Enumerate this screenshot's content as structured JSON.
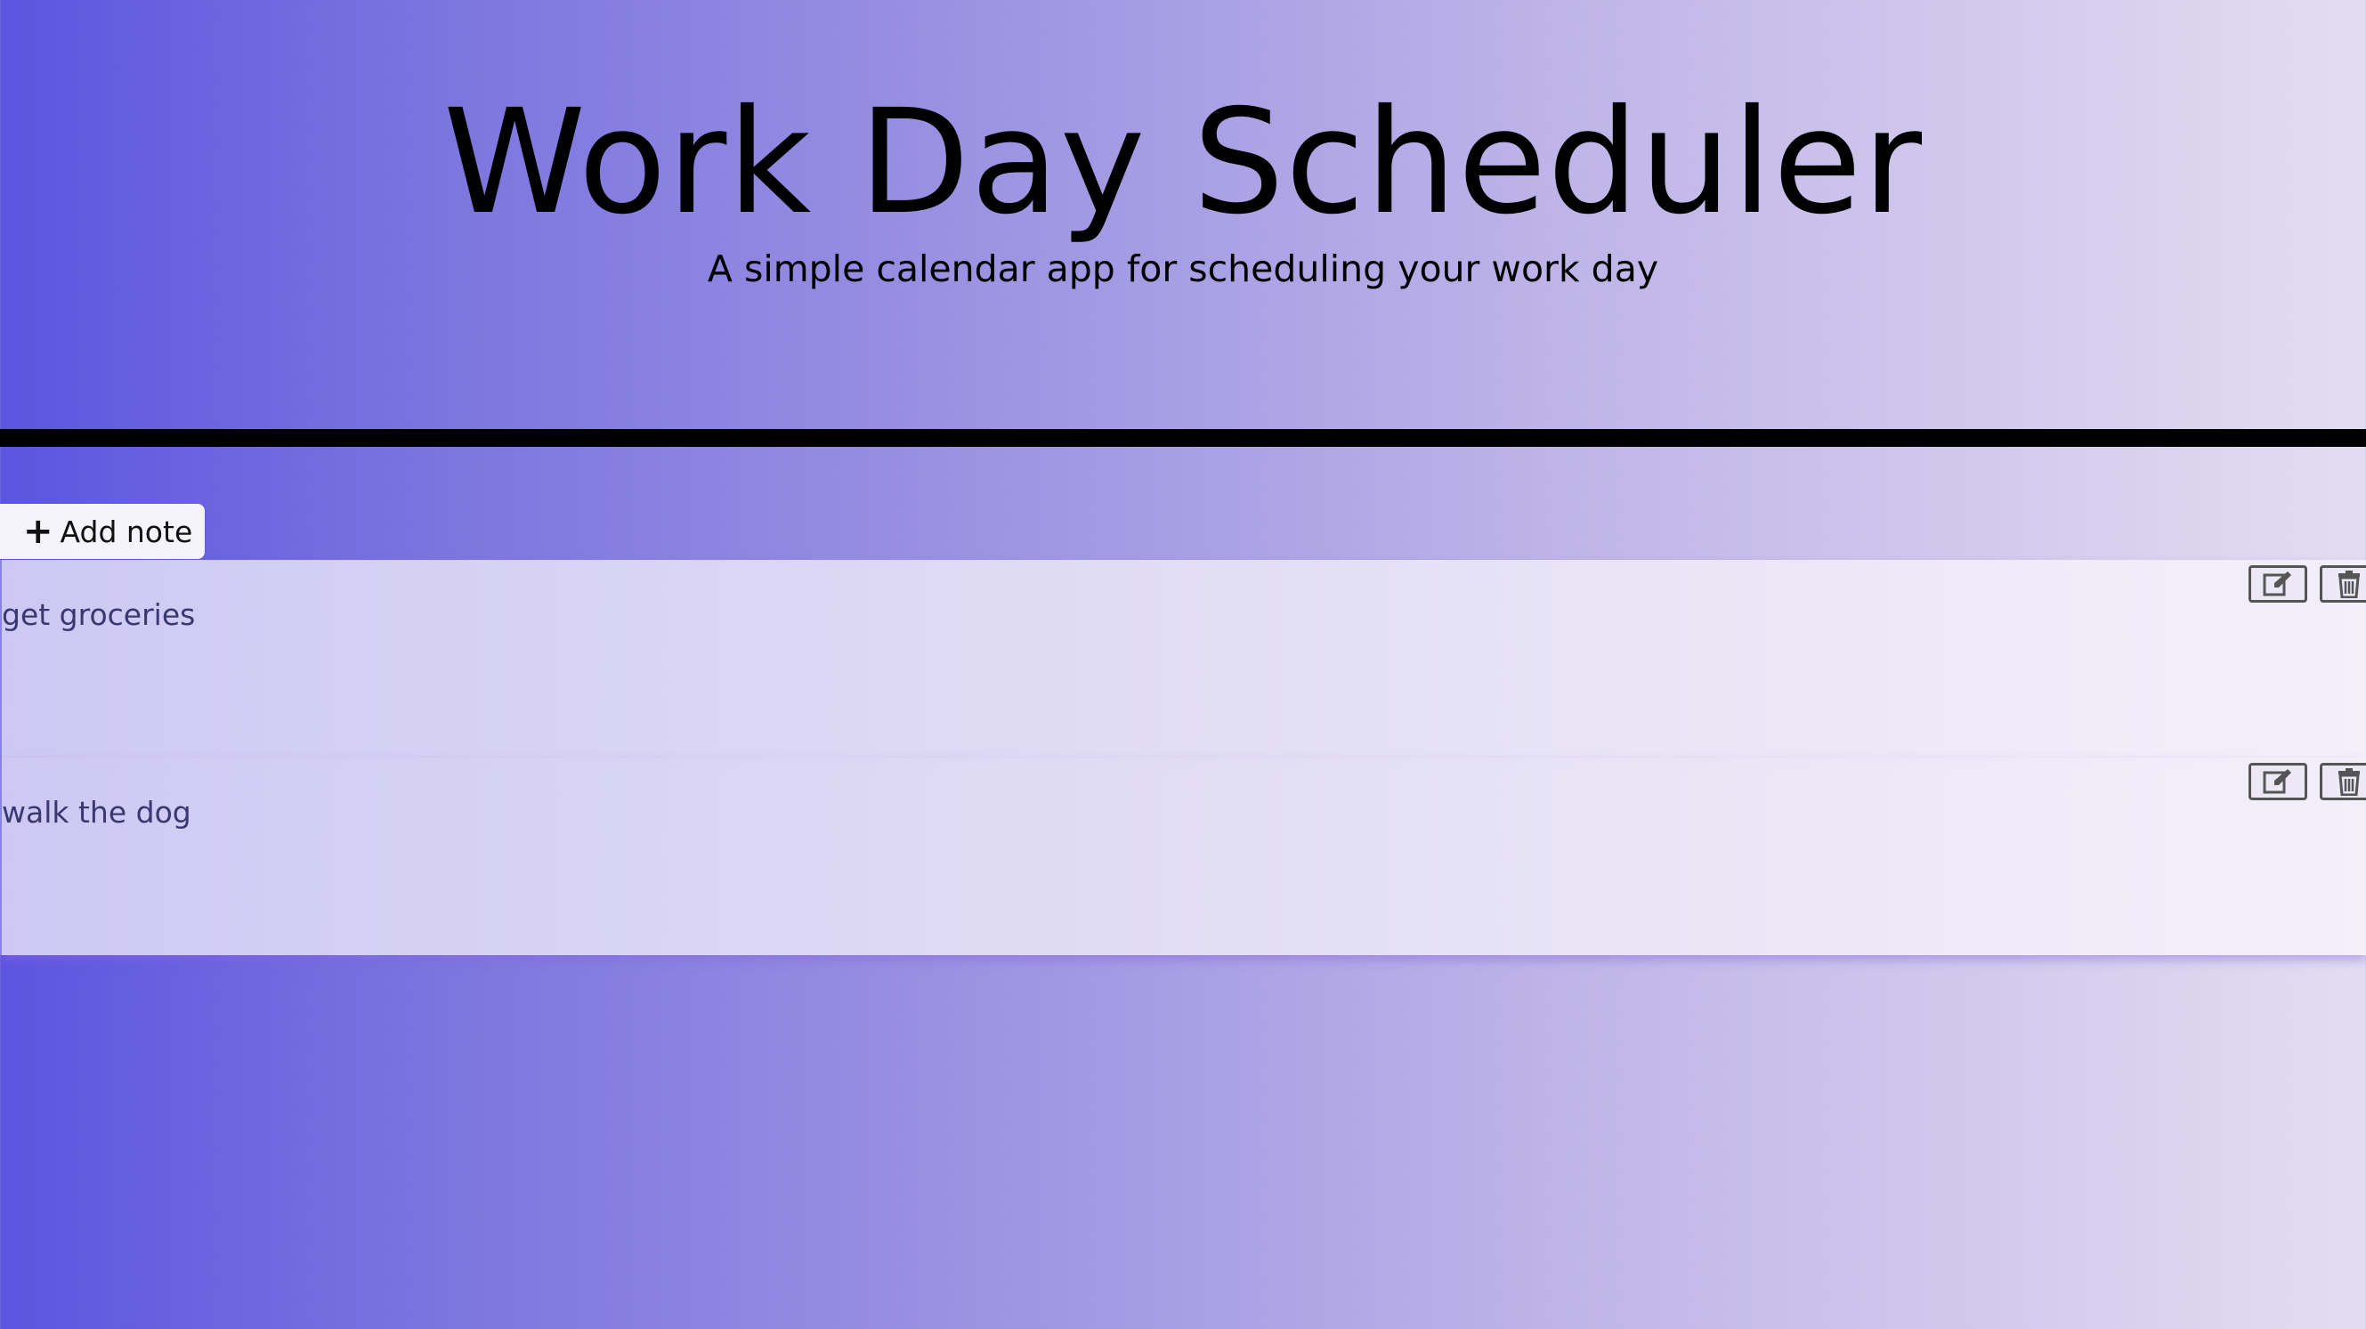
{
  "header": {
    "title": "Work Day Scheduler",
    "subtitle": "A simple calendar app for scheduling your work day"
  },
  "toolbar": {
    "add_note_label": "Add note",
    "add_note_icon": "plus-icon"
  },
  "notes": [
    {
      "text": "get groceries",
      "edit_icon": "edit-icon",
      "delete_icon": "trash-icon"
    },
    {
      "text": "walk the dog",
      "edit_icon": "edit-icon",
      "delete_icon": "trash-icon"
    }
  ],
  "colors": {
    "background_start": "#5b55e0",
    "background_end": "#e3ddf1",
    "divider": "#000000",
    "note_text": "#3a3870"
  }
}
